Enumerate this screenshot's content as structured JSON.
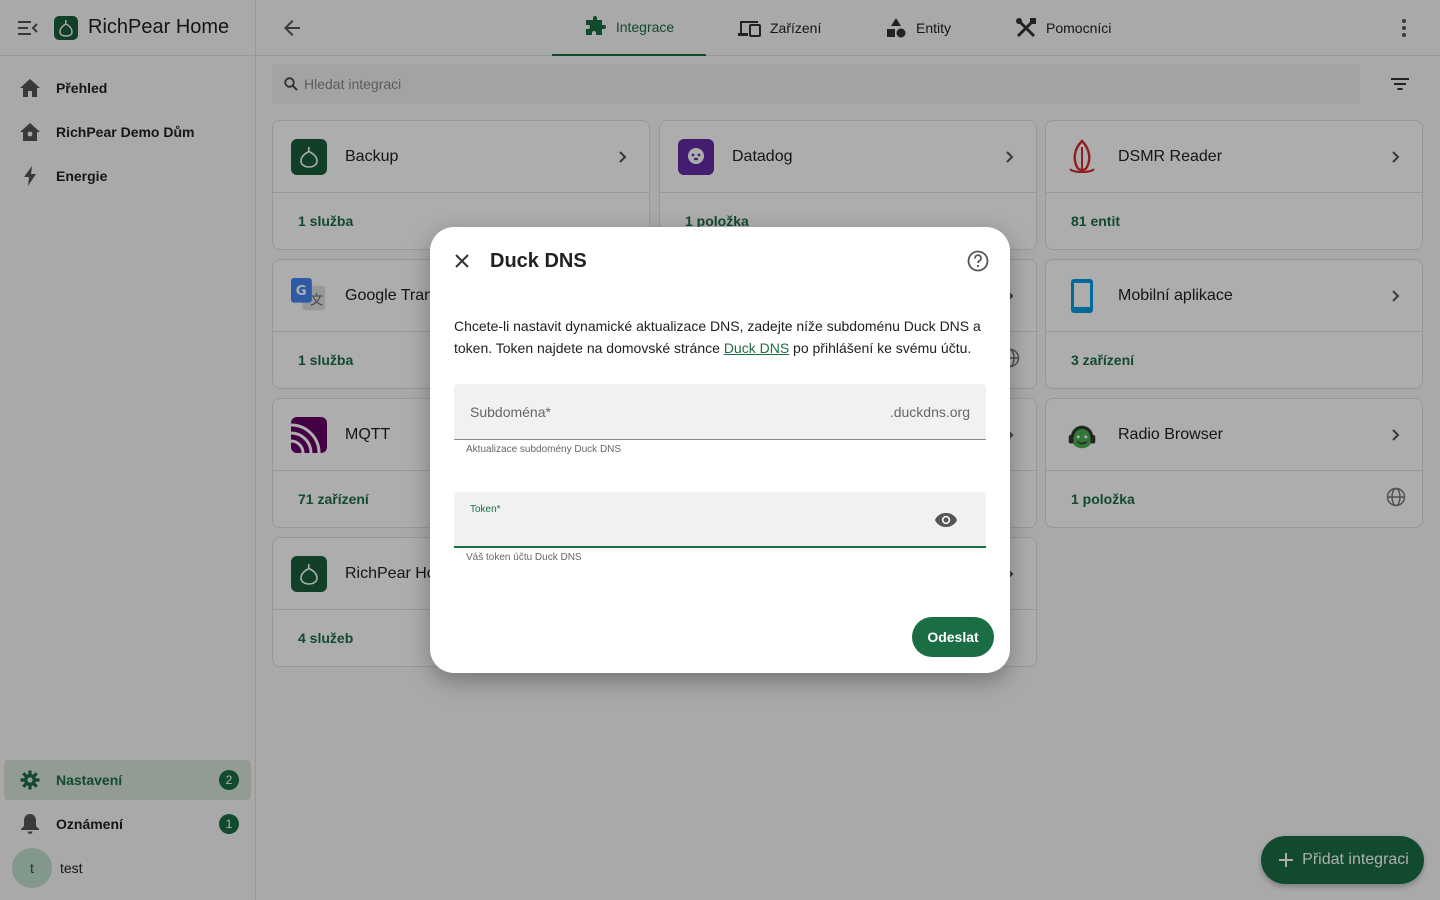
{
  "app": {
    "title": "RichPear Home"
  },
  "sidebar": {
    "items": [
      {
        "label": "Přehled",
        "icon": "home-icon"
      },
      {
        "label": "RichPear Demo Dům",
        "icon": "house-icon"
      },
      {
        "label": "Energie",
        "icon": "lightning-icon"
      }
    ],
    "bottom": [
      {
        "label": "Nastavení",
        "icon": "gear-icon",
        "badge": "2"
      },
      {
        "label": "Oznámení",
        "icon": "bell-icon",
        "badge": "1"
      }
    ],
    "user": {
      "initial": "t",
      "name": "test"
    }
  },
  "tabs": [
    {
      "label": "Integrace",
      "icon": "puzzle-icon",
      "active": true
    },
    {
      "label": "Zařízení",
      "icon": "devices-icon"
    },
    {
      "label": "Entity",
      "icon": "shapes-icon"
    },
    {
      "label": "Pomocníci",
      "icon": "tools-icon"
    }
  ],
  "search": {
    "placeholder": "Hledat integraci"
  },
  "cards": [
    {
      "name": "Backup",
      "footer": "1 služba",
      "logo": "richpear-logo"
    },
    {
      "name": "Datadog",
      "footer": "1 položka",
      "logo": "datadog-logo"
    },
    {
      "name": "DSMR Reader",
      "footer": "81 entit",
      "logo": "dsmr-logo"
    },
    {
      "name": "Google Translate",
      "footer": "1 služba",
      "logo": "google-translate-logo"
    },
    {
      "name": "Mobilní aplikace",
      "footer": "3 zařízení",
      "logo": "mobile-logo"
    },
    {
      "name": "MQTT",
      "footer": "71 zařízení",
      "logo": "mqtt-logo"
    },
    {
      "name": "Radio Browser",
      "footer": "1 položka",
      "logo": "radio-browser-logo"
    },
    {
      "name": "RichPear Home Cloud",
      "footer": "4 služeb",
      "logo": "richpear-logo"
    }
  ],
  "fab": {
    "label": "Přidat integraci"
  },
  "dialog": {
    "title": "Duck DNS",
    "desc_before": "Chcete-li nastavit dynamické aktualizace DNS, zadejte níže subdoménu Duck DNS a token. Token najdete na domovské stránce ",
    "desc_link": "Duck DNS",
    "desc_after": " po přihlášení ke svému účtu.",
    "fields": [
      {
        "label": "Subdoména*",
        "suffix": ".duckdns.org",
        "helper": "Aktualizace subdomény Duck DNS"
      },
      {
        "label": "Token*",
        "helper": "Váš token účtu Duck DNS"
      }
    ],
    "submit": "Odeslat"
  },
  "colors": {
    "primary": "#1b6e44",
    "active_bg": "#d7e6dc"
  }
}
